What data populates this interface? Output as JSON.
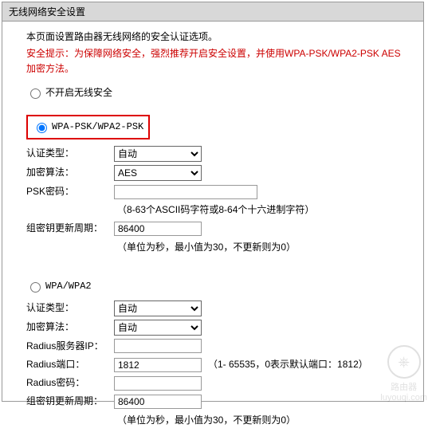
{
  "header": {
    "title": "无线网络安全设置"
  },
  "intro": "本页面设置路由器无线网络的安全认证选项。",
  "warning": "安全提示：为保障网络安全，强烈推荐开启安全设置，并使用WPA-PSK/WPA2-PSK AES加密方法。",
  "sections": {
    "nosec": {
      "label": "不开启无线安全"
    },
    "wpapsk": {
      "label": "WPA-PSK/WPA2-PSK",
      "auth_label": "认证类型：",
      "auth_options": [
        "自动"
      ],
      "auth_value": "自动",
      "enc_label": "加密算法：",
      "enc_options": [
        "AES"
      ],
      "enc_value": "AES",
      "psk_label": "PSK密码：",
      "psk_value": "",
      "psk_hint": "（8-63个ASCII码字符或8-64个十六进制字符）",
      "gk_label": "组密钥更新周期：",
      "gk_value": "86400",
      "gk_hint": "（单位为秒，最小值为30，不更新则为0）"
    },
    "wpa": {
      "label": "WPA/WPA2",
      "auth_label": "认证类型：",
      "auth_options": [
        "自动"
      ],
      "auth_value": "自动",
      "enc_label": "加密算法：",
      "enc_options": [
        "自动"
      ],
      "enc_value": "自动",
      "radius_ip_label": "Radius服务器IP：",
      "radius_ip_value": "",
      "radius_port_label": "Radius端口：",
      "radius_port_value": "1812",
      "radius_port_hint": "（1- 65535，0表示默认端口：1812）",
      "radius_pw_label": "Radius密码：",
      "radius_pw_value": "",
      "gk_label": "组密钥更新周期：",
      "gk_value": "86400",
      "gk_hint": "（单位为秒，最小值为30，不更新则为0）"
    }
  },
  "radio_selected": "wpapsk",
  "watermark": {
    "icon": "⎈",
    "text_top": "路由器",
    "text_bottom": "luyouqi.com"
  }
}
